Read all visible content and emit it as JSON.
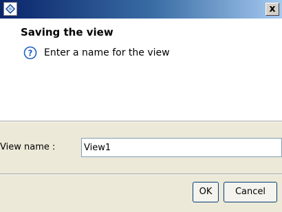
{
  "window": {
    "app_icon": "diamond-icon",
    "close_glyph": "x"
  },
  "header": {
    "title": "Saving the view",
    "message": "Enter a name for the view",
    "message_icon": "help-icon"
  },
  "form": {
    "view_name_label": "View name :",
    "view_name_value": "View1"
  },
  "buttons": {
    "ok_label": "OK",
    "cancel_label": "Cancel"
  },
  "colors": {
    "titlebar_start": "#0a246a",
    "titlebar_end": "#a6caf0",
    "help_icon": "#1f5fbf"
  }
}
